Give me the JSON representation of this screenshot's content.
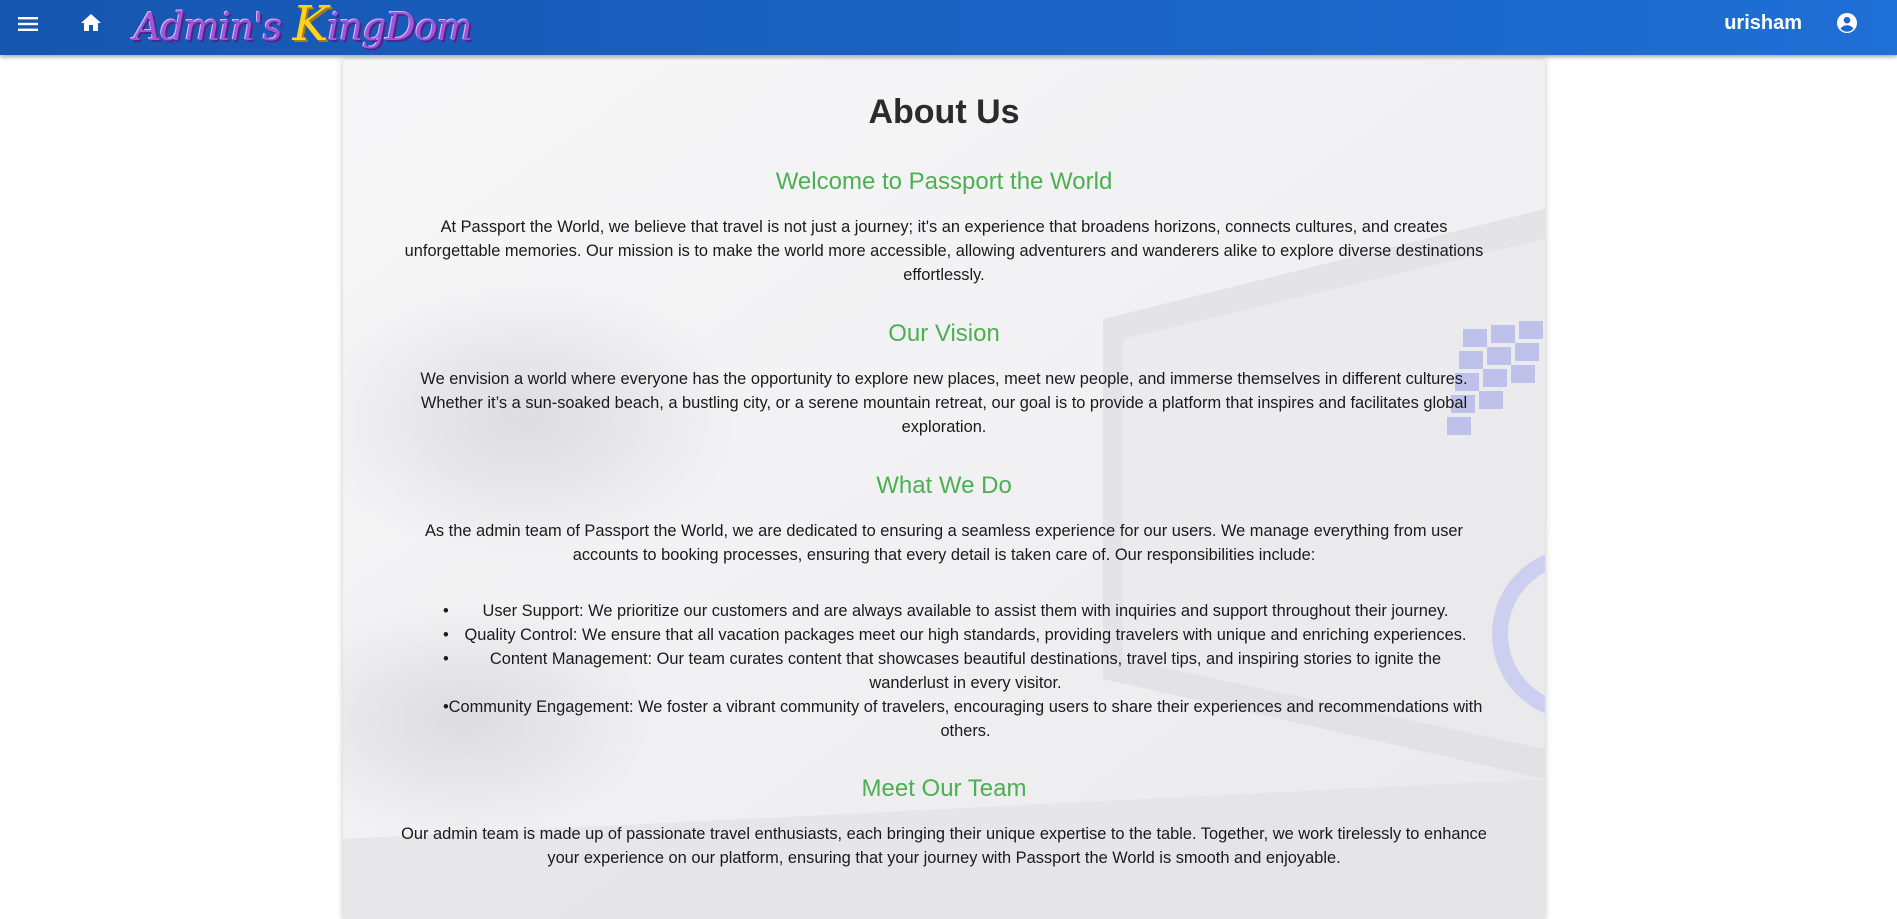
{
  "appbar": {
    "logo_prefix": "Admin's ",
    "logo_k": "K",
    "logo_suffix": "ingDom",
    "username": "urisham",
    "icons": {
      "menu": "menu-icon",
      "home": "home-icon",
      "account": "account-circle-icon"
    },
    "colors": {
      "bar": "#1b64c6",
      "logo_purple": "#9b59d6",
      "logo_yellow": "#ffd21f"
    }
  },
  "main": {
    "title": "About Us",
    "heading_color": "#4caf50",
    "sections": {
      "welcome": {
        "heading": "Welcome to Passport the World",
        "line1": "At Passport the World, we believe that travel is not just a journey; it's an experience that broadens horizons, connects cultures, and creates",
        "line2": "unforgettable memories. Our mission is to make the world more accessible, allowing adventurers and wanderers alike to explore diverse destinations",
        "line3": "effortlessly."
      },
      "vision": {
        "heading": "Our Vision",
        "line1": "We envision a world where everyone has the opportunity to explore new places, meet new people, and immerse themselves in different cultures.",
        "line2": "Whether it’s a sun-soaked beach, a bustling city, or a serene mountain retreat, our goal is to provide a platform that inspires and facilitates global",
        "line3": "exploration."
      },
      "what_we_do": {
        "heading": "What We Do",
        "line1": "As the admin team of Passport the World, we are dedicated to ensuring a seamless experience for our users. We manage everything from user",
        "line2": "accounts to booking processes, ensuring that every detail is taken care of. Our responsibilities include:",
        "items": [
          {
            "line1": "User Support: We prioritize our customers and are always available to assist them with inquiries and support throughout their journey.",
            "line2": ""
          },
          {
            "line1": "Quality Control: We ensure that all vacation packages meet our high standards, providing travelers with unique and enriching experiences.",
            "line2": ""
          },
          {
            "line1": "Content Management: Our team curates content that showcases beautiful destinations, travel tips, and inspiring stories to ignite the",
            "line2": "wanderlust in every visitor."
          },
          {
            "line1": "Community Engagement: We foster a vibrant community of travelers, encouraging users to share their experiences and recommendations with",
            "line2": "others."
          }
        ]
      },
      "team": {
        "heading": "Meet Our Team",
        "line1": "Our admin team is made up of passionate travel enthusiasts, each bringing their unique expertise to the table. Together, we work tirelessly to enhance",
        "line2": "your experience on our platform, ensuring that your journey with Passport the World is smooth and enjoyable."
      }
    }
  }
}
